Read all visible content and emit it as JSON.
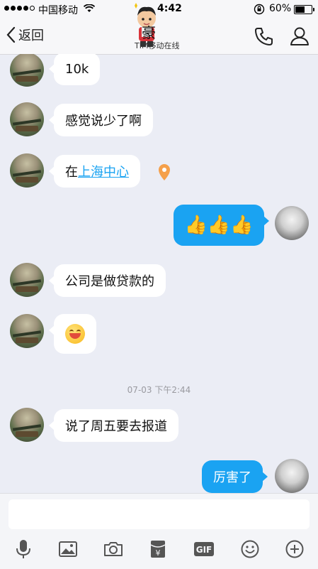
{
  "status_bar": {
    "carrier": "中国移动",
    "time": "4:42",
    "battery_percent": "60%",
    "battery_level": 0.6
  },
  "nav": {
    "back_label": "返回",
    "title": "豪",
    "subtitle": "TIM移动在线"
  },
  "messages": [
    {
      "side": "in",
      "text": "10k"
    },
    {
      "side": "in",
      "text": "感觉说少了啊"
    },
    {
      "side": "in",
      "prefix": "在",
      "link": "上海中心"
    },
    {
      "side": "out",
      "emoji": "👍👍👍"
    },
    {
      "side": "in",
      "text": "公司是做贷款的"
    },
    {
      "side": "in",
      "emoji_name": "grin-face"
    },
    {
      "timestamp": "07-03 下午2:44"
    },
    {
      "side": "in",
      "text": "说了周五要去报道"
    },
    {
      "side": "out",
      "text": "厉害了"
    }
  ],
  "toolbar": {
    "icons": [
      "microphone-icon",
      "image-icon",
      "camera-icon",
      "red-packet-icon",
      "gif-icon",
      "emoji-icon",
      "plus-icon"
    ],
    "gif_label": "GIF",
    "red_packet_label": "¥"
  },
  "colors": {
    "accent": "#1aa3f2",
    "background": "#ebedf5",
    "location_pin": "#f5a04a"
  }
}
